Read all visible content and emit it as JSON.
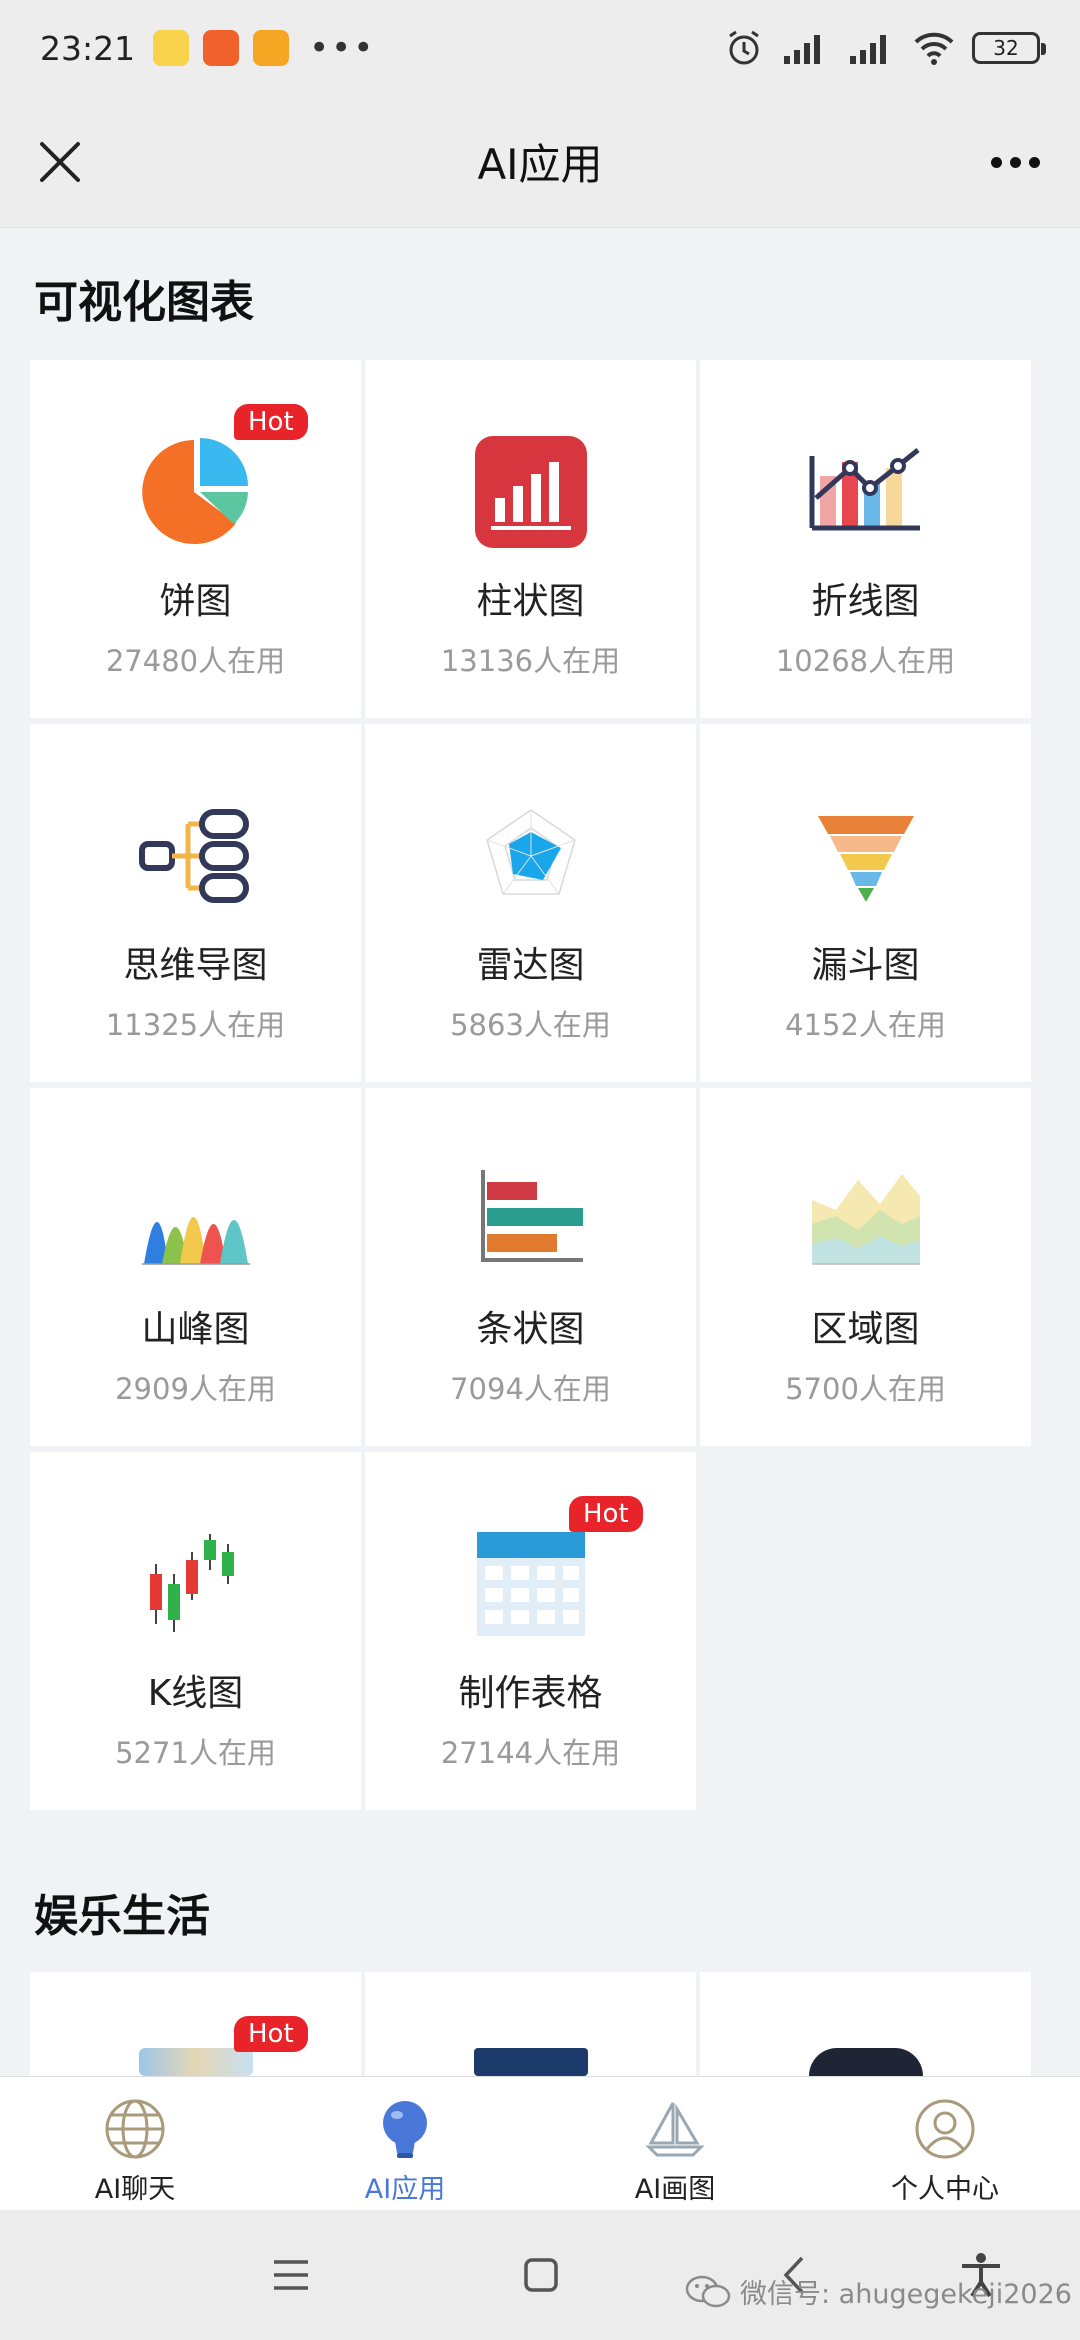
{
  "status_bar": {
    "time": "23:21",
    "battery": "32",
    "more": "•••"
  },
  "header": {
    "title": "AI应用"
  },
  "sections": [
    {
      "title": "可视化图表"
    },
    {
      "title": "娱乐生活"
    }
  ],
  "charts": [
    {
      "name": "饼图",
      "count": "27480人在用",
      "icon": "pie-chart-icon",
      "hot": "Hot"
    },
    {
      "name": "柱状图",
      "count": "13136人在用",
      "icon": "bar-chart-icon"
    },
    {
      "name": "折线图",
      "count": "10268人在用",
      "icon": "line-chart-icon"
    },
    {
      "name": "思维导图",
      "count": "11325人在用",
      "icon": "mind-map-icon"
    },
    {
      "name": "雷达图",
      "count": "5863人在用",
      "icon": "radar-chart-icon"
    },
    {
      "name": "漏斗图",
      "count": "4152人在用",
      "icon": "funnel-chart-icon"
    },
    {
      "name": "山峰图",
      "count": "2909人在用",
      "icon": "peak-chart-icon"
    },
    {
      "name": "条状图",
      "count": "7094人在用",
      "icon": "horizontal-bar-icon"
    },
    {
      "name": "区域图",
      "count": "5700人在用",
      "icon": "area-chart-icon"
    },
    {
      "name": "K线图",
      "count": "5271人在用",
      "icon": "candlestick-icon"
    },
    {
      "name": "制作表格",
      "count": "27144人在用",
      "icon": "table-icon",
      "hot": "Hot"
    }
  ],
  "entertainment": [
    {
      "icon": "photo-collage-icon",
      "hot": "Hot"
    },
    {
      "icon": "night-scene-icon"
    },
    {
      "icon": "dark-circle-icon"
    }
  ],
  "bottom_nav": [
    {
      "label": "AI聊天",
      "icon": "globe-icon"
    },
    {
      "label": "AI应用",
      "icon": "lightbulb-icon",
      "active": true
    },
    {
      "label": "AI画图",
      "icon": "sailboat-icon"
    },
    {
      "label": "个人中心",
      "icon": "user-icon"
    }
  ],
  "watermark": "微信号: ahugegekeji2026",
  "colors": {
    "hot": "#e8232a",
    "active": "#4a78d8",
    "background": "#f0f2f6"
  }
}
